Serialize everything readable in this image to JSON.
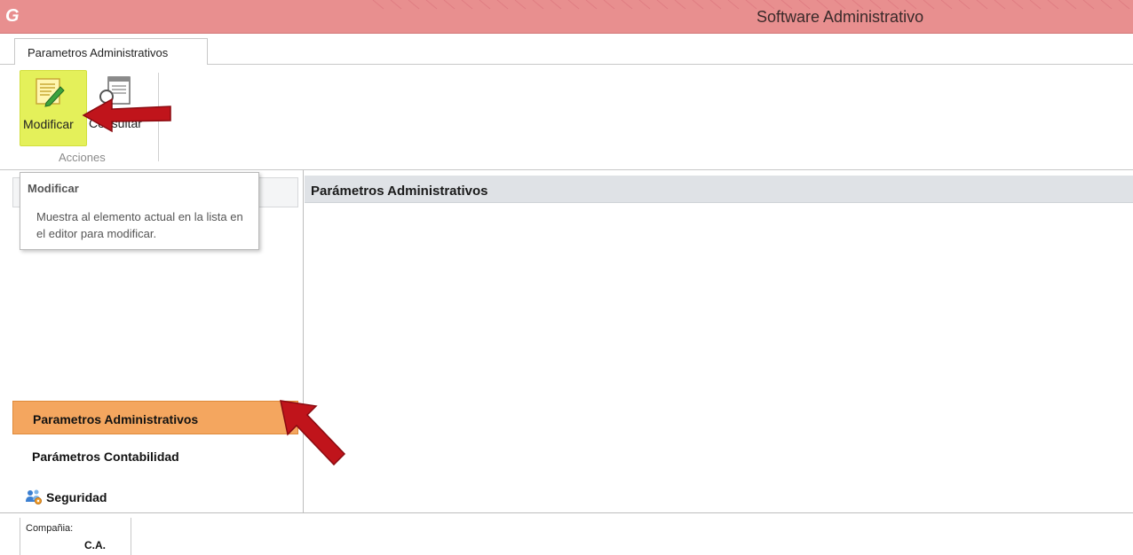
{
  "window": {
    "title": "Software Administrativo",
    "logo_letter": "G"
  },
  "ribbon": {
    "tab_label": "Parametros Administrativos",
    "buttons": {
      "modificar": "Modificar",
      "consultar": "Consultar"
    },
    "group_label": "Acciones"
  },
  "tooltip": {
    "title": "Modificar",
    "body": "Muestra al elemento actual en la lista en el editor para modificar."
  },
  "nav": {
    "items": [
      {
        "label": "Parametros Administrativos",
        "active": true
      },
      {
        "label": "Parámetros Contabilidad",
        "active": false
      },
      {
        "label": "Seguridad",
        "active": false,
        "icon": "users-gear-icon"
      }
    ]
  },
  "content": {
    "header": "Parámetros Administrativos"
  },
  "status": {
    "company_label": "Compañia:",
    "company_value": "C.A."
  },
  "colors": {
    "titlebar": "#e88f8f",
    "highlight_button": "#e4f05a",
    "active_nav": "#f4a65f",
    "arrow": "#c0141b"
  }
}
